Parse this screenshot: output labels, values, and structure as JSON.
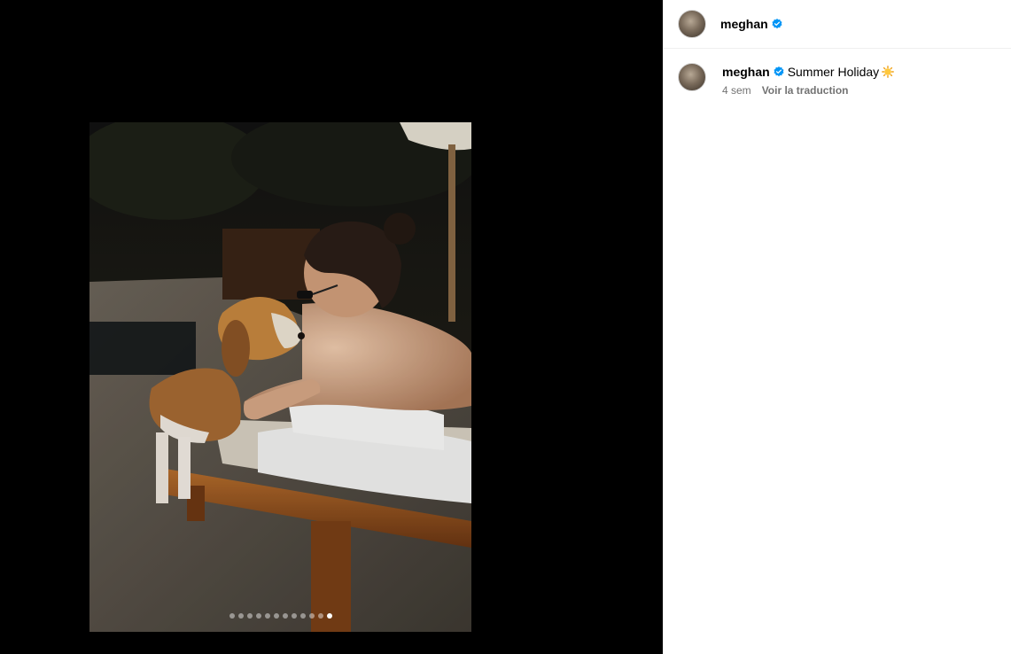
{
  "post": {
    "username": "meghan",
    "verified": true,
    "image_alt": "Woman lying on a sun lounger nose to nose with a beagle",
    "carousel": {
      "total": 12,
      "active_index": 11
    }
  },
  "caption": {
    "username": "meghan",
    "text": "Summer Holiday",
    "emoji": "sun-emoji",
    "time": "4 sem",
    "translate_label": "Voir la traduction"
  },
  "colors": {
    "verified": "#0095f6",
    "meta_text": "#737373",
    "divider": "#efefef"
  }
}
